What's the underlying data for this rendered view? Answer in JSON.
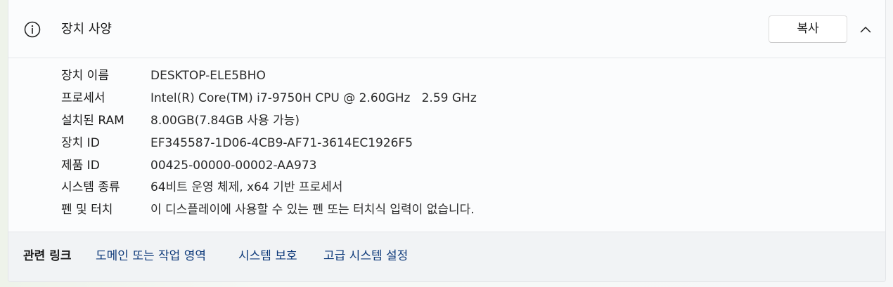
{
  "header": {
    "title": "장치 사양",
    "copy_label": "복사"
  },
  "specs": [
    {
      "label": "장치 이름",
      "value": "DESKTOP-ELE5BHO"
    },
    {
      "label": "프로세서",
      "value": "Intel(R) Core(TM) i7-9750H CPU @ 2.60GHz   2.59 GHz"
    },
    {
      "label": "설치된 RAM",
      "value": "8.00GB(7.84GB 사용 가능)"
    },
    {
      "label": "장치 ID",
      "value": "EF345587-1D06-4CB9-AF71-3614EC1926F5"
    },
    {
      "label": "제품 ID",
      "value": "00425-00000-00002-AA973"
    },
    {
      "label": "시스템 종류",
      "value": "64비트 운영 체제, x64 기반 프로세서"
    },
    {
      "label": "펜 및 터치",
      "value": "이 디스플레이에 사용할 수 있는 펜 또는 터치식 입력이 없습니다."
    }
  ],
  "related": {
    "title": "관련 링크",
    "links": [
      "도메인 또는 작업 영역",
      "시스템 보호",
      "고급 시스템 설정"
    ]
  },
  "colors": {
    "link": "#0e3a7a",
    "card_background": "#fbfcfd",
    "related_background": "#f1f3f5"
  },
  "icons": {
    "header": "info-icon",
    "collapse": "chevron-up-icon"
  }
}
